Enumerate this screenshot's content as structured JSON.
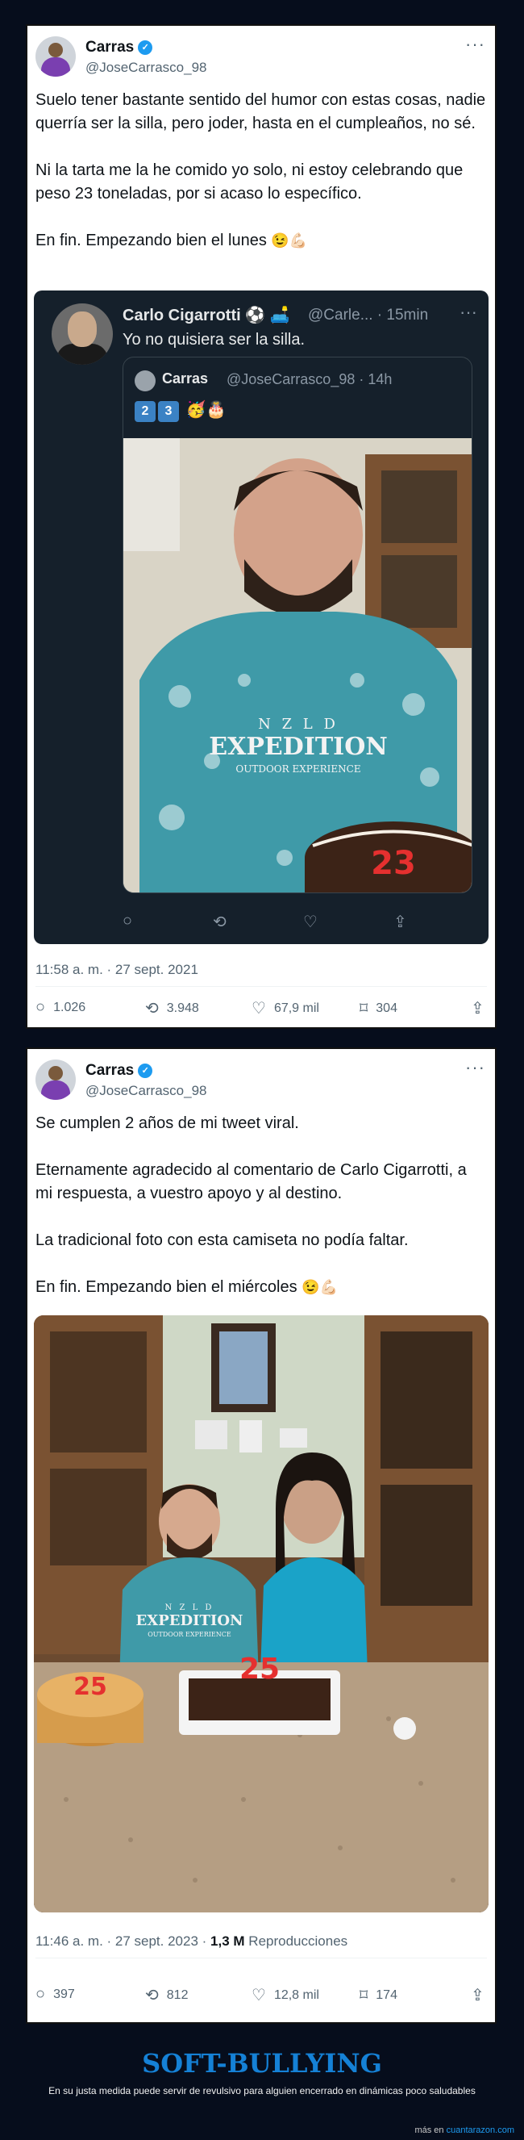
{
  "tweet1": {
    "name": "Carras",
    "handle": "@JoseCarrasco_98",
    "more": "···",
    "paragraphs": [
      "Suelo tener bastante sentido del humor con estas cosas, nadie querría ser la silla, pero joder, hasta en el cumpleaños, no sé.",
      "Ni la tarta me la he comido yo solo, ni estoy celebrando que peso 23 toneladas, por si acaso lo específico.",
      "En fin. Empezando bien el lunes"
    ],
    "emoji_end": "😉💪🏻",
    "quote": {
      "name": "Carlo Cigarrotti ⚽️ 🛋️",
      "meta": "@Carle... · 15min",
      "more": "···",
      "text": "Yo no quisiera ser la silla.",
      "inner": {
        "name": "Carras",
        "meta": "@JoseCarrasco_98 · 14h",
        "key1": "2",
        "key2": "3",
        "emojis": "🥳🎂",
        "shirt_line1": "N Z L D",
        "shirt_line2": "EXPEDITION",
        "shirt_line3": "OUTDOOR EXPERIENCE",
        "cake_number": "23"
      },
      "actions": {
        "reply": "○",
        "retweet": "⟲",
        "like": "♡",
        "share": "⇪"
      }
    },
    "timestamp": "11:58 a. m. · 27 sept. 2021",
    "counts": {
      "replies": "1.026",
      "retweets": "3.948",
      "likes": "67,9 mil",
      "bookmarks": "304"
    }
  },
  "tweet2": {
    "name": "Carras",
    "handle": "@JoseCarrasco_98",
    "more": "···",
    "paragraphs": [
      "Se cumplen 2 años de mi tweet viral.",
      "Eternamente agradecido al comentario de Carlo Cigarrotti, a mi respuesta, a vuestro apoyo y al destino.",
      "La tradicional foto con esta camiseta no podía faltar.",
      "En fin. Empezando bien el miércoles"
    ],
    "emoji_end": "😉💪🏻",
    "photo": {
      "shirt_line1": "N Z L D",
      "shirt_line2": "EXPEDITION",
      "shirt_line3": "OUTDOOR EXPERIENCE",
      "cake_left": "25",
      "cake_right": "25"
    },
    "timestamp": "11:46 a. m. · 27 sept. 2023 · ",
    "views": "1,3 M",
    "views_label": " Reproducciones",
    "counts": {
      "replies": "397",
      "retweets": "812",
      "likes": "12,8 mil",
      "bookmarks": "174"
    }
  },
  "footer": {
    "title": "SOFT-BULLYING",
    "subtitle": "En su justa medida puede servir de revulsivo para alguien encerrado en dinámicas poco saludables",
    "credit_prefix": "más en ",
    "credit_site": "cuantarazon.com"
  },
  "icons": {
    "reply": "○",
    "retweet": "⟲",
    "like": "♡",
    "bookmark": "⌑",
    "share": "⇪",
    "verified": "✓"
  },
  "colors": {
    "accent": "#1d9bf0",
    "title": "#1581d6",
    "background": "#060d1c",
    "quote_bg": "#15202b"
  }
}
